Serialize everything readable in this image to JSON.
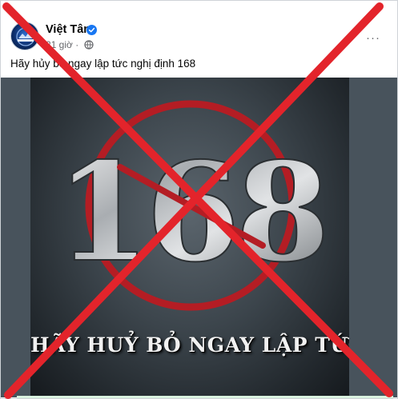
{
  "post": {
    "page_name": "Việt Tân",
    "time": "21 giờ",
    "caption": "Hãy hủy bỏ ngay lập tức nghị định 168",
    "more_label": "···"
  },
  "poster": {
    "number": "168",
    "slogan": "HÃY HUỶ BỎ NGAY LẬP TỨC"
  },
  "overlay": {
    "cross_color": "#e3242b"
  },
  "colors": {
    "verified": "#1877f2",
    "prohibition_ring": "#b41d24"
  }
}
